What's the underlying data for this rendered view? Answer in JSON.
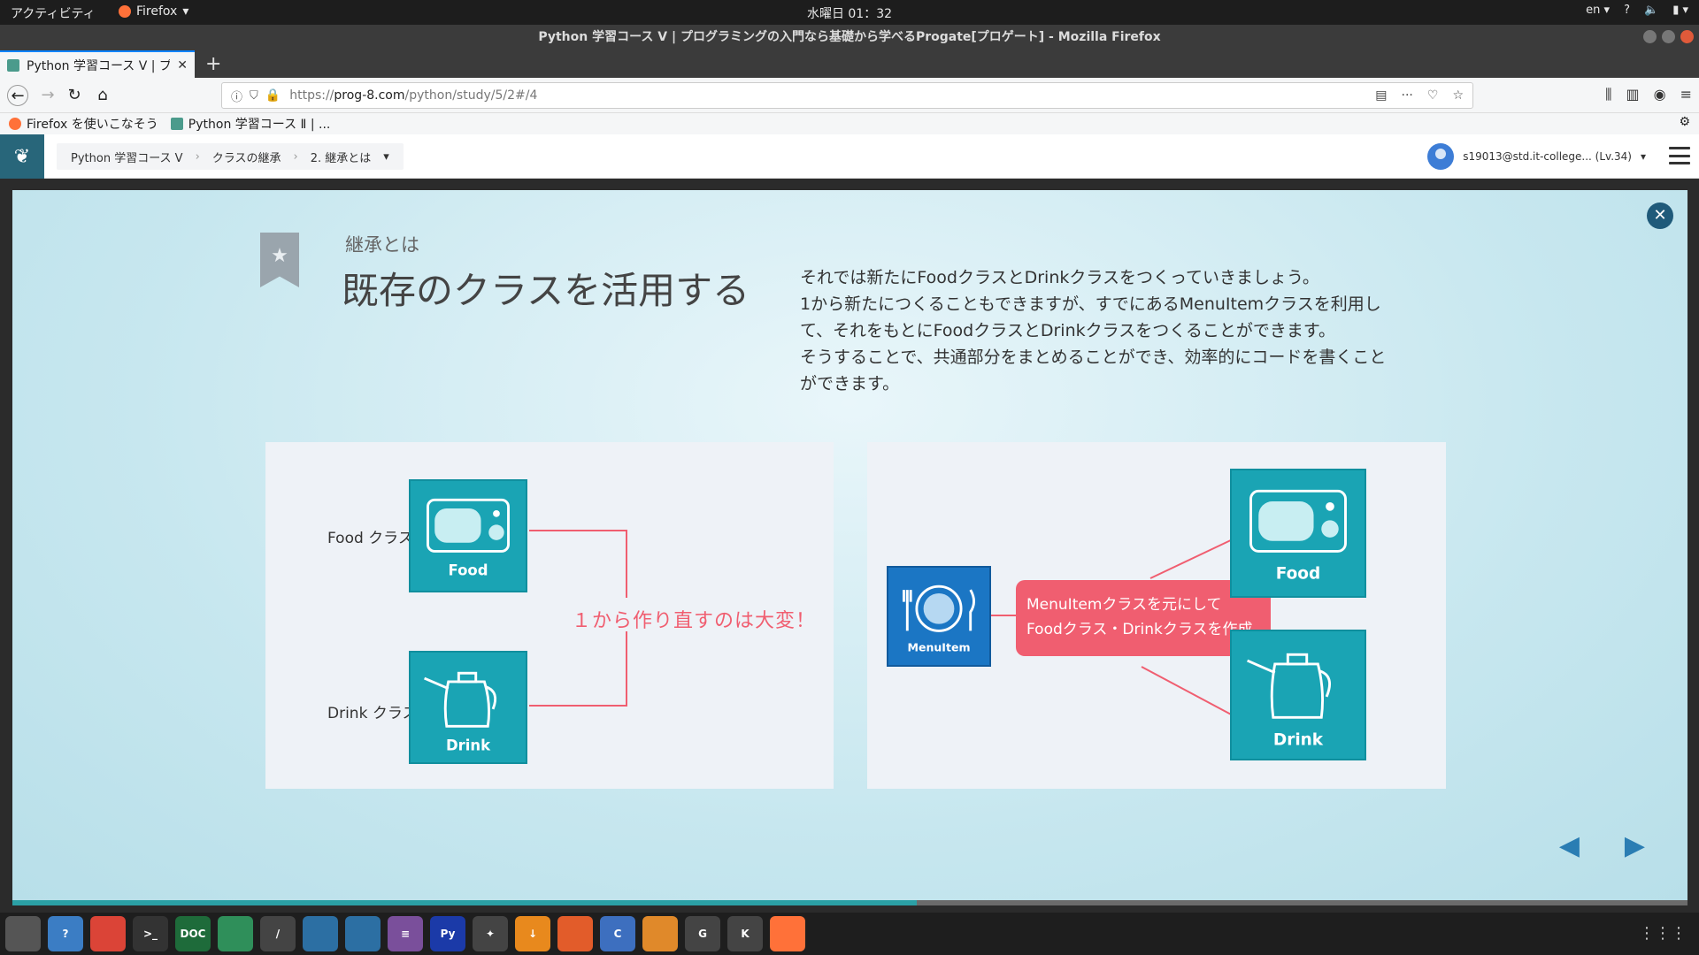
{
  "system": {
    "activities": "アクティビティ",
    "app_menu": "Firefox",
    "clock": "水曜日 01：32",
    "lang": "en",
    "help": "?"
  },
  "window": {
    "title": "Python 学習コース Ⅴ | プログラミングの入門なら基礎から学べるProgate[プロゲート] - Mozilla Firefox"
  },
  "tabs": [
    {
      "label": "Python 学習コース Ⅴ | プ"
    }
  ],
  "url": {
    "host_prefix": "https://",
    "host": "prog-8.com",
    "path": "/python/study/5/2#/4"
  },
  "bookmarks": [
    {
      "label": "Firefox を使いこなそう"
    },
    {
      "label": "Python 学習コース Ⅱ | ..."
    }
  ],
  "header": {
    "breadcrumb": [
      "Python 学習コース Ⅴ",
      "クラスの継承",
      "2. 継承とは"
    ],
    "user": "s19013@std.it-college... (Lv.34)"
  },
  "slide": {
    "subtitle": "継承とは",
    "title": "既存のクラスを活用する",
    "description": [
      "それでは新たにFoodクラスとDrinkクラスをつくっていきましょう。",
      "1から新たにつくることもできますが、すでにあるMenuItemクラスを利用し",
      "て、それをもとにFoodクラスとDrinkクラスをつくることができます。",
      "そうすることで、共通部分をまとめることができ、効率的にコードを書くこと",
      "ができます。"
    ],
    "left": {
      "food_label": "Food クラス",
      "drink_label": "Drink クラス",
      "food_icon_text": "Food",
      "drink_icon_text": "Drink",
      "message": "１から作り直すのは大変！"
    },
    "right": {
      "menuitem_icon_text": "MenuItem",
      "bubble_line1": "MenuItemクラスを元にして",
      "bubble_line2": "Foodクラス・Drinkクラスを作成",
      "food_icon_text": "Food",
      "drink_icon_text": "Drink"
    },
    "prev": "◀",
    "next": "▶"
  },
  "progress": {
    "value": 0.54
  },
  "dock": [
    {
      "name": "files",
      "label": "",
      "color": "#555"
    },
    {
      "name": "help",
      "label": "?",
      "color": "#3b7dc4"
    },
    {
      "name": "chrome",
      "label": "",
      "color": "#db4437"
    },
    {
      "name": "terminal",
      "label": ">_",
      "color": "#333"
    },
    {
      "name": "doc",
      "label": "DOC",
      "color": "#1e6b3a"
    },
    {
      "name": "atom",
      "label": "",
      "color": "#2f8f5a"
    },
    {
      "name": "sublime",
      "label": "/",
      "color": "#444"
    },
    {
      "name": "eclipse1",
      "label": "",
      "color": "#2c6fa3"
    },
    {
      "name": "eclipse2",
      "label": "",
      "color": "#2c6fa3"
    },
    {
      "name": "emacs",
      "label": "≡",
      "color": "#7a4f9b"
    },
    {
      "name": "pyizm",
      "label": "Py",
      "color": "#1b3aa8"
    },
    {
      "name": "sparkle",
      "label": "✦",
      "color": "#444"
    },
    {
      "name": "download",
      "label": "↓",
      "color": "#e8891d"
    },
    {
      "name": "character",
      "label": "",
      "color": "#e25c2a"
    },
    {
      "name": "c-lang",
      "label": "C",
      "color": "#3d6fbf"
    },
    {
      "name": "network",
      "label": "",
      "color": "#e0892a"
    },
    {
      "name": "g-app",
      "label": "G",
      "color": "#444"
    },
    {
      "name": "k-app",
      "label": "K",
      "color": "#444"
    },
    {
      "name": "firefox",
      "label": "",
      "color": "#ff7139"
    }
  ]
}
